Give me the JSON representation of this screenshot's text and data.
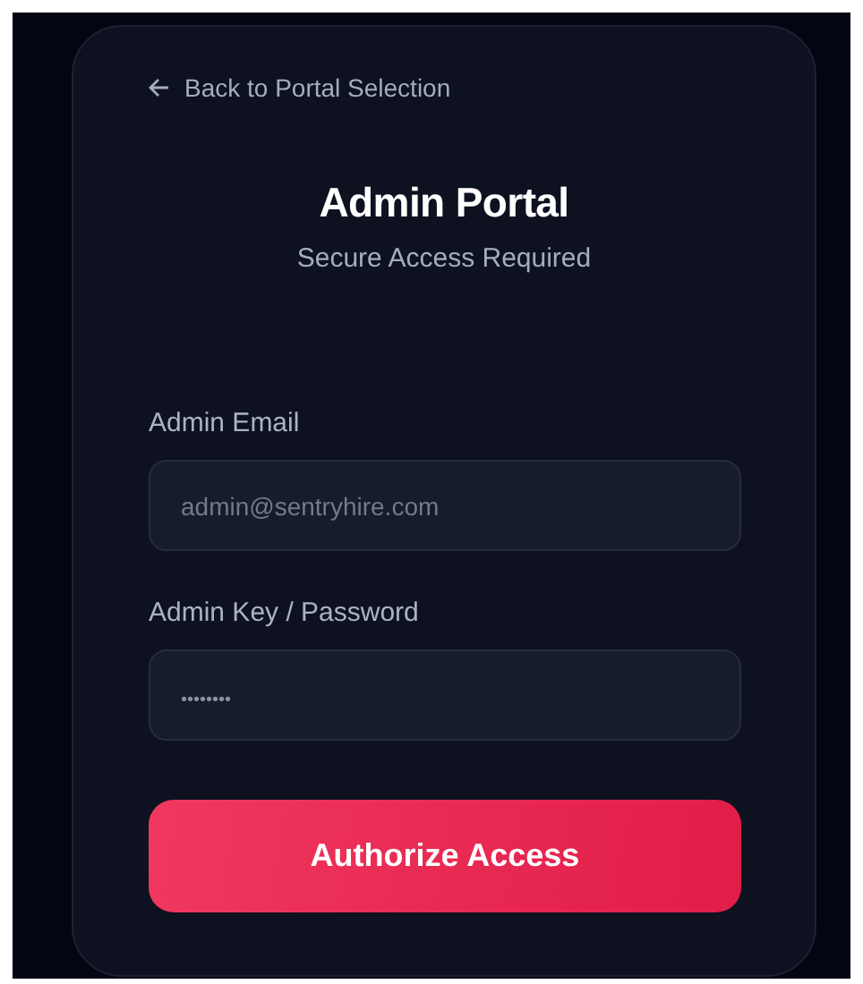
{
  "back_link": {
    "label": "Back to Portal Selection"
  },
  "title": "Admin Portal",
  "subtitle": "Secure Access Required",
  "fields": [
    {
      "label": "Admin Email",
      "placeholder": "admin@sentryhire.com",
      "kind": "email"
    },
    {
      "label": "Admin Key / Password",
      "placeholder": "••••••••",
      "kind": "password"
    }
  ],
  "submit_button": "Authorize Access"
}
